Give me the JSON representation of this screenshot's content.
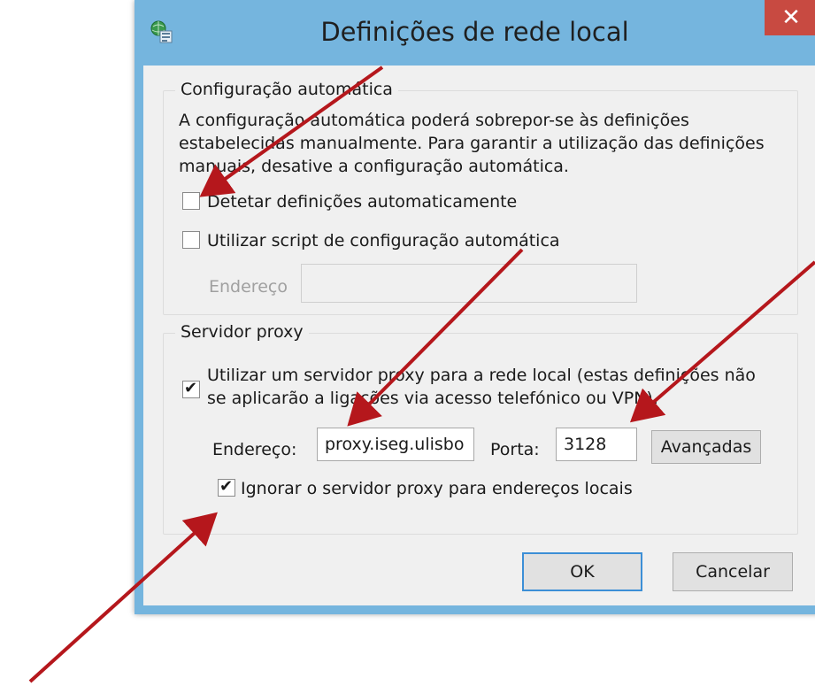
{
  "dialog": {
    "title": "Definições de rede local",
    "close_glyph": "✕",
    "colors": {
      "frame": "#75b5de",
      "close": "#c84a41",
      "client": "#f0f0f0",
      "arrow": "#b5171c"
    }
  },
  "auto_config": {
    "group_label": "Configuração automática",
    "description_lines": [
      "A configuração automática poderá sobrepor-se às definições",
      "estabelecidas manualmente. Para garantir a utilização das definições",
      "manuais, desative a configuração automática."
    ],
    "detect_label": "Detetar definições automaticamente",
    "detect_checked": false,
    "script_label": "Utilizar script de configuração automática",
    "script_checked": false,
    "address_label": "Endereço",
    "address_value": ""
  },
  "proxy": {
    "group_label": "Servidor proxy",
    "use_proxy_lines": [
      "Utilizar um servidor proxy para a rede local (estas definições não",
      "se aplicarão a ligações via acesso telefónico ou VPN)."
    ],
    "use_proxy_checked": true,
    "address_label": "Endereço:",
    "address_value": "proxy.iseg.ulisbo",
    "port_label": "Porta:",
    "port_value": "3128",
    "advanced_label": "Avançadas",
    "bypass_label": "Ignorar o servidor proxy para endereços locais",
    "bypass_checked": true
  },
  "buttons": {
    "ok_label": "OK",
    "cancel_label": "Cancelar"
  },
  "icons": {
    "title_icon": "network-globe-icon",
    "tick": "✔"
  }
}
